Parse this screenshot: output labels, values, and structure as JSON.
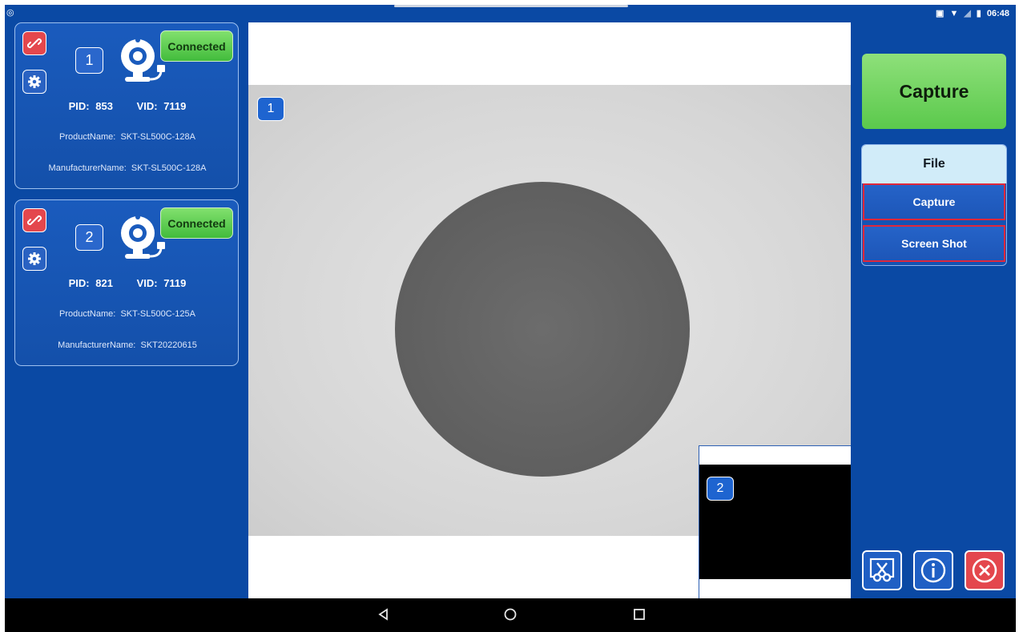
{
  "status_bar": {
    "time": "06:48",
    "icons": [
      "cast-icon",
      "wifi-icon",
      "signal-icon",
      "battery-icon"
    ]
  },
  "cameras": [
    {
      "index": "1",
      "status": "Connected",
      "pid_label": "PID:",
      "pid": "853",
      "vid_label": "VID:",
      "vid": "7119",
      "product_label": "ProductName:",
      "product": "SKT-SL500C-128A",
      "manufacturer_label": "ManufacturerName:",
      "manufacturer": "SKT-SL500C-128A"
    },
    {
      "index": "2",
      "status": "Connected",
      "pid_label": "PID:",
      "pid": "821",
      "vid_label": "VID:",
      "vid": "7119",
      "product_label": "ProductName:",
      "product": "SKT-SL500C-125A",
      "manufacturer_label": "ManufacturerName:",
      "manufacturer": "SKT20220615"
    }
  ],
  "viewer": {
    "main_badge": "1",
    "pip_badge": "2"
  },
  "right_panel": {
    "capture_label": "Capture",
    "file_header": "File",
    "file_items": [
      "Capture",
      "Screen Shot"
    ],
    "bottom_buttons": [
      "screenshot-scissors-icon",
      "info-icon",
      "close-icon"
    ]
  },
  "colors": {
    "background": "#0a49a4",
    "connected": "#5cc94b",
    "unlink": "#e4474d",
    "highlight_border": "#e0283b",
    "file_header": "#d1ecf9"
  },
  "nav_bar": {
    "buttons": [
      "back-icon",
      "home-icon",
      "recents-icon"
    ]
  }
}
